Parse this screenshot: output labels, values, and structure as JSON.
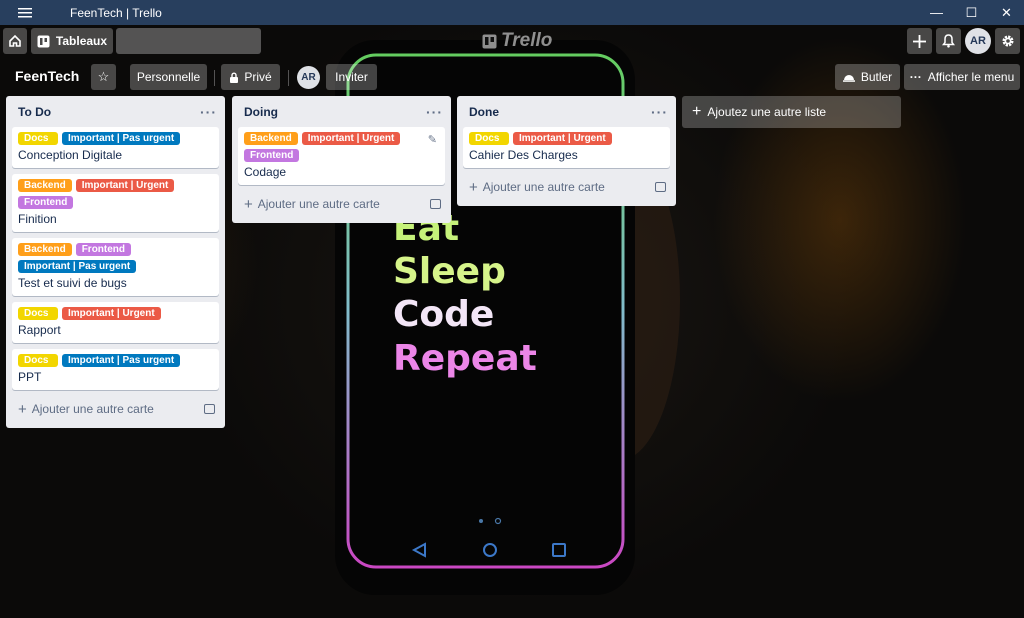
{
  "window": {
    "title": "FeenTech | Trello",
    "minimize": "—",
    "maximize": "☐",
    "close": "✕"
  },
  "header": {
    "boards_label": "Tableaux",
    "search_value": "",
    "logo_text": "Trello",
    "avatar_initials": "AR"
  },
  "board": {
    "name": "FeenTech",
    "visibility_team": "Personnelle",
    "visibility_private": "Privé",
    "member_initials": "AR",
    "invite_label": "Inviter",
    "butler_label": "Butler",
    "menu_label": "Afficher le menu"
  },
  "label_colors": {
    "Docs": "#f2d600",
    "Important | Pas urgent": "#0079bf",
    "Backend": "#ff9f1a",
    "Important | Urgent": "#eb5a46",
    "Frontend": "#c377e0"
  },
  "lists": [
    {
      "title": "To Do",
      "cards": [
        {
          "labels": [
            "Docs",
            "Important | Pas urgent"
          ],
          "title": "Conception Digitale"
        },
        {
          "labels": [
            "Backend",
            "Important | Urgent",
            "Frontend"
          ],
          "title": "Finition"
        },
        {
          "labels": [
            "Backend",
            "Frontend",
            "Important | Pas urgent"
          ],
          "title": "Test et suivi de bugs"
        },
        {
          "labels": [
            "Docs",
            "Important | Urgent"
          ],
          "title": "Rapport"
        },
        {
          "labels": [
            "Docs",
            "Important | Pas urgent"
          ],
          "title": "PPT"
        }
      ],
      "add_card_label": "Ajouter une autre carte"
    },
    {
      "title": "Doing",
      "cards": [
        {
          "labels": [
            "Backend",
            "Important | Urgent",
            "Frontend"
          ],
          "title": "Codage"
        }
      ],
      "add_card_label": "Ajouter une autre carte"
    },
    {
      "title": "Done",
      "cards": [
        {
          "labels": [
            "Docs",
            "Important | Urgent"
          ],
          "title": "Cahier Des Charges"
        }
      ],
      "add_card_label": "Ajouter une autre carte"
    }
  ],
  "add_list_label": "Ajoutez une autre liste",
  "background_art": {
    "lines": [
      "Eat",
      "Sleep",
      "Code",
      "Repeat"
    ]
  }
}
